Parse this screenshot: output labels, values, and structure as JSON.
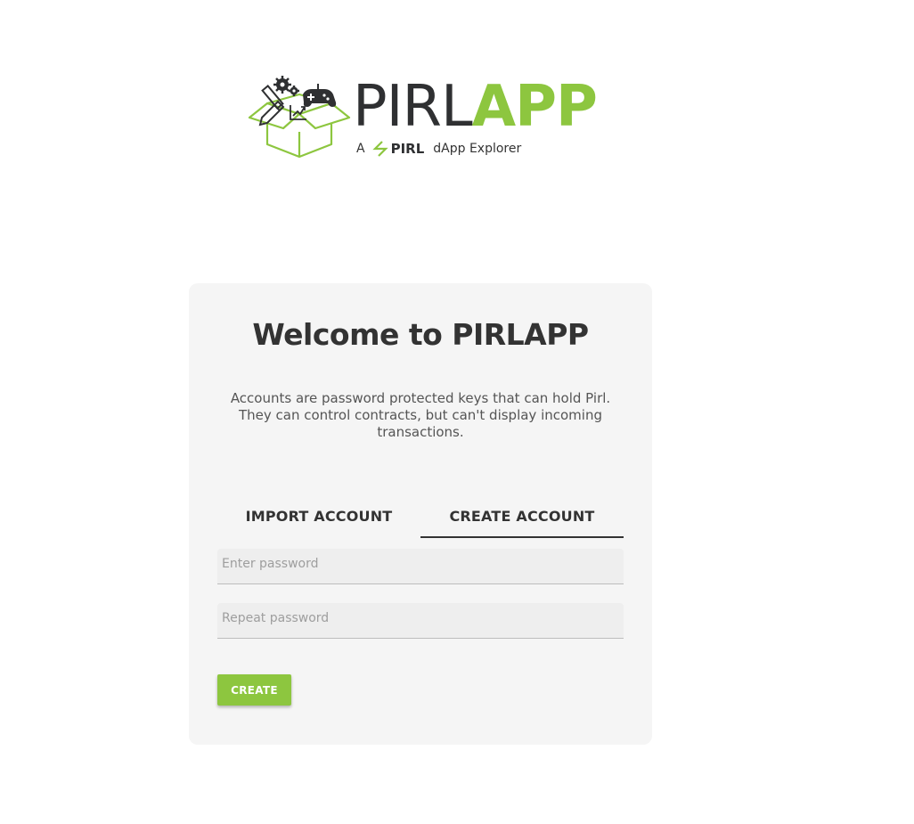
{
  "brand": {
    "word_dark": "PIRL",
    "word_green": "APP",
    "tagline_prefix": "A",
    "tagline_brand": "PIRL",
    "tagline_suffix": "dApp Explorer",
    "colors": {
      "green": "#8dc63f",
      "dark": "#2f3032"
    }
  },
  "card": {
    "title": "Welcome to PIRLAPP",
    "description": "Accounts are password protected keys that can hold Pirl. They can control contracts, but can't display incoming transactions.",
    "tabs": [
      {
        "label": "IMPORT ACCOUNT",
        "active": false
      },
      {
        "label": "CREATE ACCOUNT",
        "active": true
      }
    ],
    "password": {
      "placeholder": "Enter password",
      "value": ""
    },
    "repeat_password": {
      "placeholder": "Repeat password",
      "value": ""
    },
    "create_button": {
      "label": "CREATE",
      "color": "#8dc63f"
    }
  }
}
